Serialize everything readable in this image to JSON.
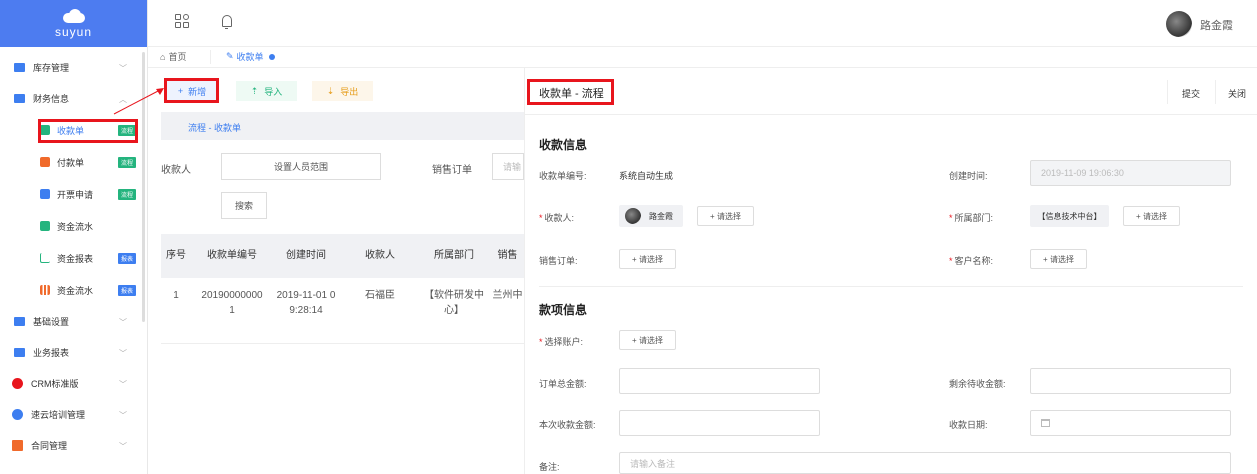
{
  "sidebar": {
    "brand": "suyun",
    "menus": [
      {
        "label": "库存管理",
        "icon": "folder-icon",
        "color": "#3d7ef0"
      },
      {
        "label": "财务信息",
        "icon": "folder-icon",
        "color": "#3d7ef0"
      }
    ],
    "subitems": [
      {
        "label": "收款单",
        "tag": "流程",
        "tag_color": "green",
        "icon": "edit-icon",
        "color": "#24b47e"
      },
      {
        "label": "付款单",
        "tag": "流程",
        "tag_color": "green",
        "icon": "payment-icon",
        "color": "#f06a2b"
      },
      {
        "label": "开票申请",
        "tag": "流程",
        "tag_color": "green",
        "icon": "invoice-icon",
        "color": "#3d7ef0"
      },
      {
        "label": "资金流水",
        "tag": "",
        "icon": "cashflow-icon",
        "color": "#24b47e"
      },
      {
        "label": "资金报表",
        "tag": "报表",
        "tag_color": "blue",
        "icon": "line-chart-icon",
        "color": "#24b47e"
      },
      {
        "label": "资金流水",
        "tag": "报表",
        "tag_color": "blue",
        "icon": "bar-chart-icon",
        "color": "#f06a2b"
      }
    ],
    "menus_bottom": [
      {
        "label": "基础设置",
        "icon": "folder-icon",
        "color": "#3d7ef0"
      },
      {
        "label": "业务报表",
        "icon": "folder-icon",
        "color": "#3d7ef0"
      },
      {
        "label": "CRM标准版",
        "icon": "crm-icon",
        "color": "#e8151d"
      },
      {
        "label": "速云培训管理",
        "icon": "training-icon",
        "color": "#3d7ef0"
      },
      {
        "label": "合同管理",
        "icon": "contract-icon",
        "color": "#f06a2b"
      }
    ]
  },
  "header": {
    "username": "路金霞"
  },
  "tabs": {
    "home": "首页",
    "current": "收款单"
  },
  "toolbar": {
    "add": "新增",
    "import": "导入",
    "export": "导出"
  },
  "list": {
    "flow_label": "流程 - 收款单",
    "filter_payee_label": "收款人",
    "filter_payee_btn": "设置人员范围",
    "filter_order_label": "销售订单",
    "filter_order_placeholder": "请输",
    "search_btn": "搜索",
    "columns": [
      "序号",
      "收款单编号",
      "创建时间",
      "收款人",
      "所属部门",
      "销售"
    ],
    "rows": [
      {
        "index": "1",
        "number_line1": "20190000000",
        "number_line2": "1",
        "time_line1": "2019-11-01 0",
        "time_line2": "9:28:14",
        "payee": "石福臣",
        "dept_line1": "【软件研发中",
        "dept_line2": "心】",
        "order": "兰州中"
      }
    ]
  },
  "panel": {
    "title": "收款单 - 流程",
    "submit": "提交",
    "close": "关闭",
    "section1": "收款信息",
    "number_label": "收款单编号:",
    "number_value": "系统自动生成",
    "created_label": "创建时间:",
    "created_value": "2019-11-09 19:06:30",
    "payee_label": "收款人:",
    "payee_value": "路金霞",
    "pick": "+ 请选择",
    "dept_label": "所属部门:",
    "dept_value": "【信息技术中台】",
    "order_label": "销售订单:",
    "customer_label": "客户名称:",
    "section2": "款项信息",
    "account_label": "选择账户:",
    "order_total_label": "订单总金额:",
    "remaining_label": "剩余待收金额:",
    "this_amount_label": "本次收款金额:",
    "date_label": "收款日期:",
    "remark_label": "备注:",
    "remark_placeholder": "请输入备注"
  },
  "colors": {
    "accent": "#3d7ef0",
    "highlight": "#e8151d",
    "brand_bg": "#4d7cf0"
  }
}
